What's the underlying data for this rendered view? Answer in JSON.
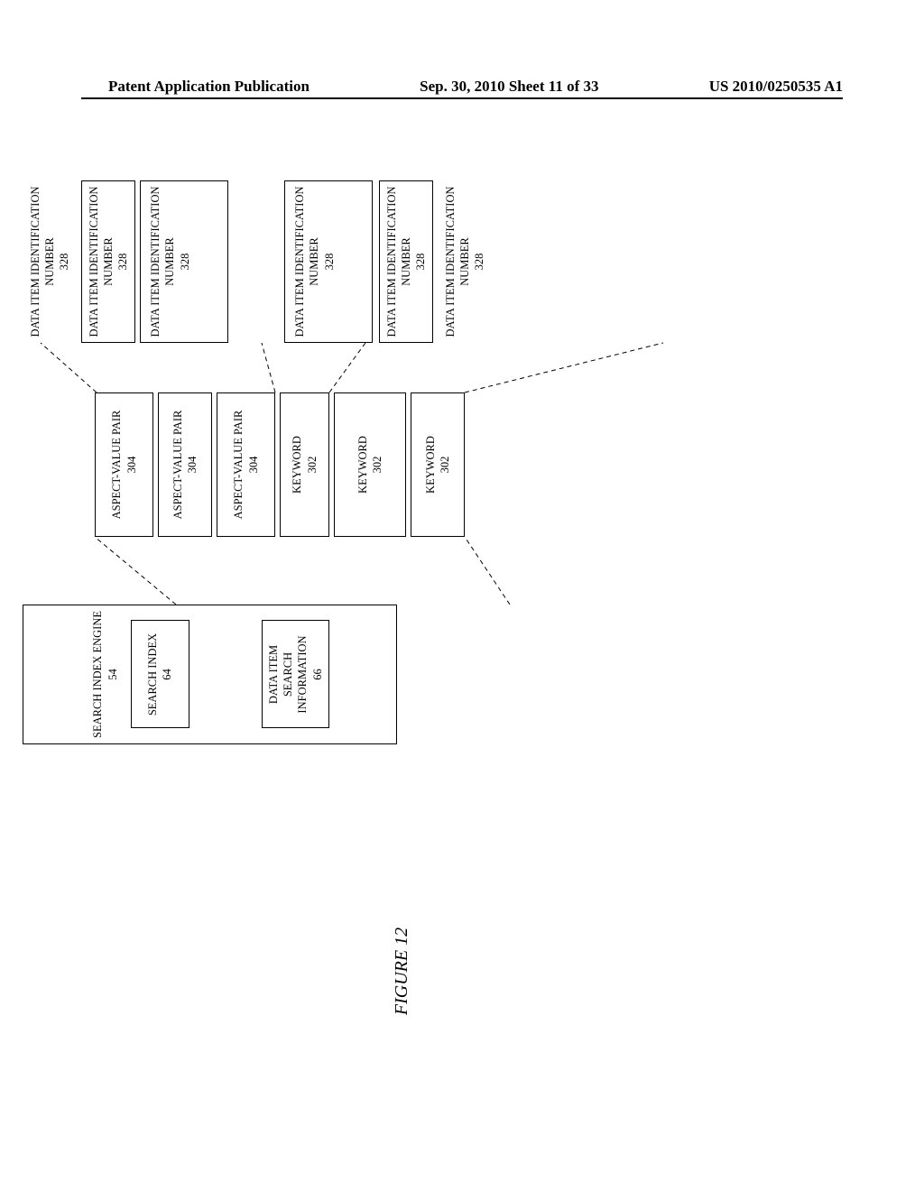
{
  "header": {
    "left": "Patent Application Publication",
    "center": "Sep. 30, 2010  Sheet 11 of 33",
    "right": "US 2010/0250535 A1"
  },
  "figure_label": "FIGURE 12",
  "blocks": {
    "search_index_engine": {
      "title": "SEARCH INDEX ENGINE",
      "ref": "54"
    },
    "search_index": {
      "title": "SEARCH INDEX",
      "ref": "64"
    },
    "data_item_search_info": {
      "title": "DATA ITEM SEARCH INFORMATION",
      "ref": "66"
    },
    "aspect_value_pair": {
      "title": "ASPECT-VALUE PAIR",
      "ref": "304"
    },
    "keyword": {
      "title": "KEYWORD",
      "ref": "302"
    },
    "data_item_id": {
      "title": "DATA ITEM IDENTIFICATION NUMBER",
      "ref": "328"
    }
  }
}
